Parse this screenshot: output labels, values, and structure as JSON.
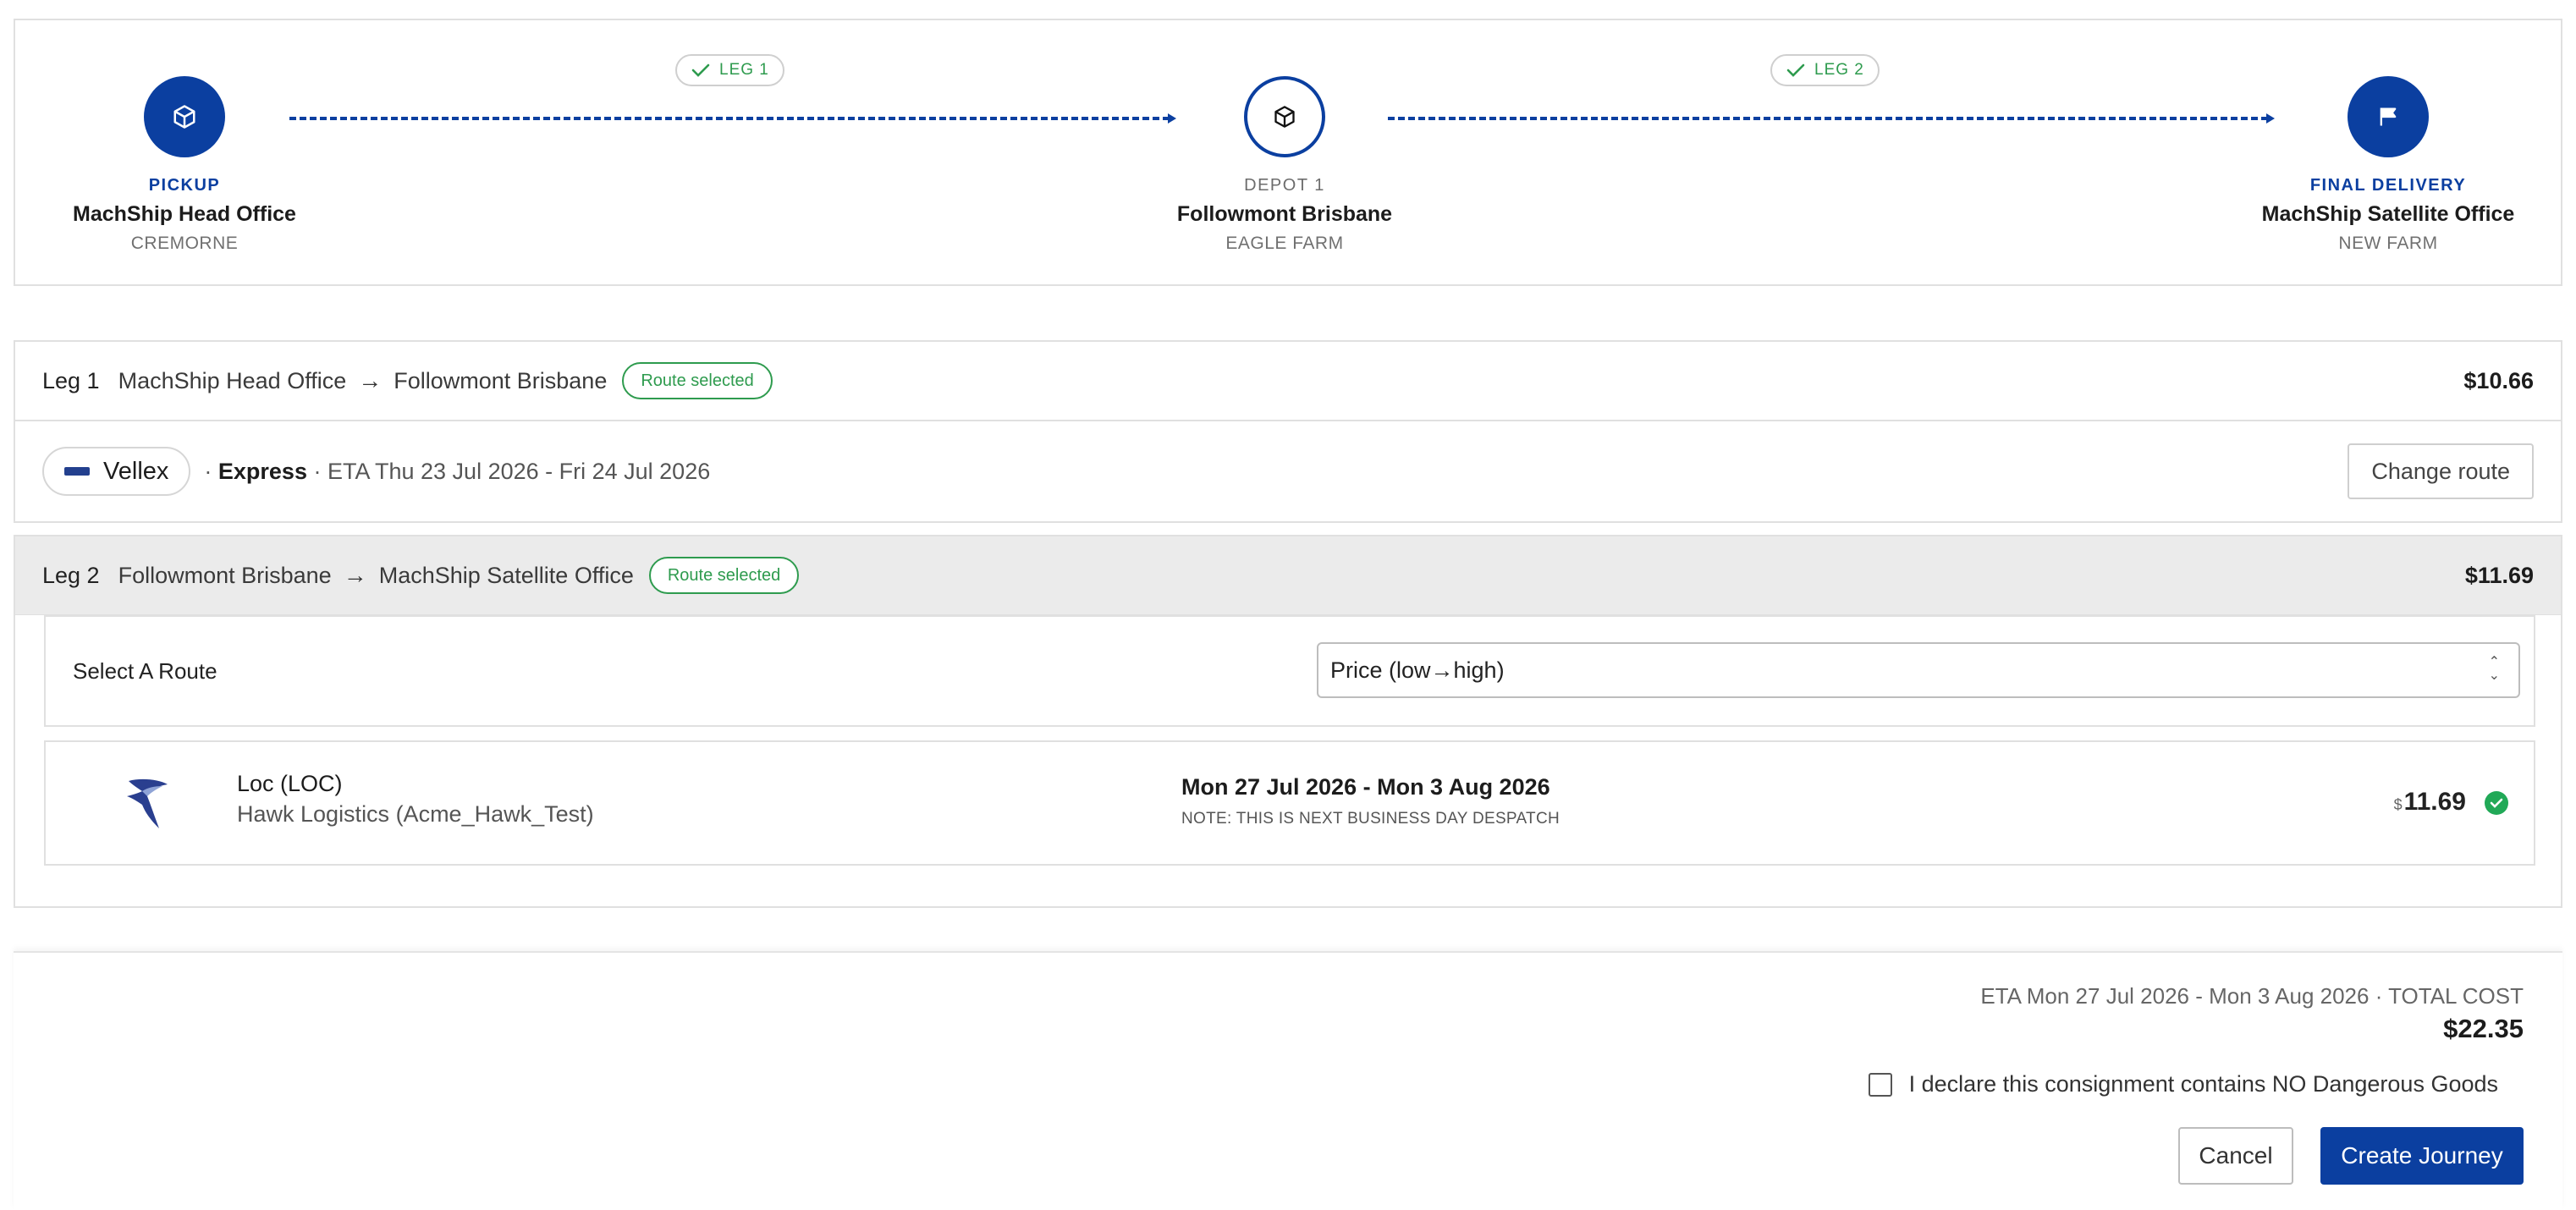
{
  "journey": {
    "stops": [
      {
        "kind": "PICKUP",
        "name": "MachShip Head Office",
        "suburb": "CREMORNE",
        "icon": "box-icon"
      },
      {
        "kind": "DEPOT 1",
        "name": "Followmont Brisbane",
        "suburb": "EAGLE FARM",
        "icon": "box-icon"
      },
      {
        "kind": "FINAL DELIVERY",
        "name": "MachShip Satellite Office",
        "suburb": "NEW FARM",
        "icon": "flag-icon"
      }
    ],
    "legs": [
      {
        "label": "LEG 1"
      },
      {
        "label": "LEG 2"
      }
    ]
  },
  "leg1": {
    "number": "Leg 1",
    "from": "MachShip Head Office",
    "to": "Followmont Brisbane",
    "badge": "Route selected",
    "price": "$10.66",
    "carrier": "Vellex",
    "logo_text": "VELLEX",
    "service": "Express",
    "eta": "ETA Thu 23 Jul 2026 - Fri 24 Jul 2026",
    "change_button": "Change route"
  },
  "leg2": {
    "number": "Leg 2",
    "from": "Followmont Brisbane",
    "to": "MachShip Satellite Office",
    "badge": "Route selected",
    "price": "$11.69",
    "select_label": "Select A Route",
    "sort_value": "Price (low→high)",
    "route": {
      "name": "Loc (LOC)",
      "carrier": "Hawk Logistics (Acme_Hawk_Test)",
      "eta": "Mon 27 Jul 2026 - Mon 3 Aug 2026",
      "note": "NOTE: THIS IS NEXT BUSINESS DAY DESPATCH",
      "currency": "$",
      "price": "11.69"
    }
  },
  "footer": {
    "eta_summary": "ETA Mon 27 Jul 2026 - Mon 3 Aug 2026 · TOTAL COST",
    "total": "$22.35",
    "declaration": "I declare this consignment contains NO Dangerous Goods",
    "declaration_checked": false,
    "cancel": "Cancel",
    "create": "Create Journey"
  },
  "colors": {
    "brand": "#0b3fa0",
    "success": "#2e9b4e"
  }
}
